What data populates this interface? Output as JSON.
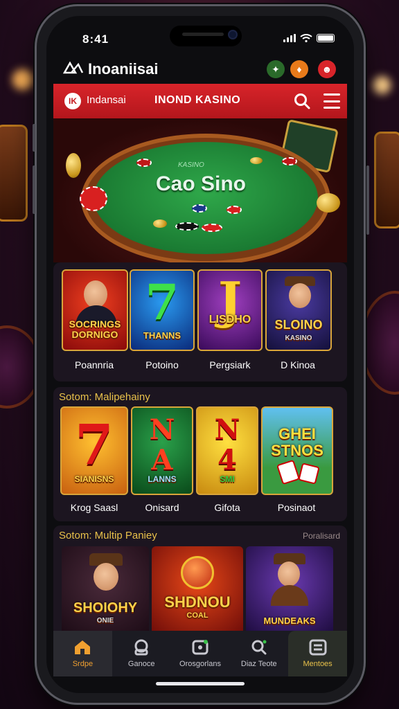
{
  "status_bar": {
    "time": "8:41"
  },
  "app_header": {
    "title": "Inoaniisai"
  },
  "navbar": {
    "brand": "Indansai",
    "title": "INOND KASINO"
  },
  "hero": {
    "felt_text": "Cao Sino",
    "felt_subtext": "KASINO"
  },
  "section_top": {
    "tiles": [
      {
        "art_text": "SOCRINGS DORNIGO",
        "label": "Poannria"
      },
      {
        "art_text": "7",
        "art_sub": "THANNS",
        "label": "Potoino"
      },
      {
        "art_text": "J",
        "art_sub": "LISDHO",
        "label": "Pergsiark"
      },
      {
        "art_text": "SLOINO",
        "art_sub": "KASINO",
        "label": "D Kinoa"
      }
    ]
  },
  "section_middle": {
    "title": "Sotom: Malipehainy",
    "tiles": [
      {
        "art_text": "7",
        "art_sub": "SIANISNS",
        "label": "Krog Saasl"
      },
      {
        "art_text": "N A",
        "art_sub": "LANNS",
        "label": "Onisard"
      },
      {
        "art_text": "N 4",
        "art_sub": "SMI",
        "label": "Gifota"
      },
      {
        "art_text": "GHEI STNOS",
        "art_sub": "",
        "label": "Posinaot"
      }
    ]
  },
  "section_bottom": {
    "title": "Sotom: Multip Paniey",
    "link": "Poralisard",
    "tiles": [
      {
        "art_text": "SHOIOHY",
        "art_sub": "ONIE"
      },
      {
        "art_text": "SHDNOU",
        "art_sub": "COAL"
      },
      {
        "art_text": "MUNDEAKS",
        "art_sub": ""
      }
    ]
  },
  "bottom_nav": {
    "items": [
      {
        "label": "Srdpe",
        "icon": "home-icon",
        "active": true
      },
      {
        "label": "Ganoce",
        "icon": "casino-icon",
        "active": false
      },
      {
        "label": "Orosgorlans",
        "icon": "games-icon",
        "active": false
      },
      {
        "label": "Diaz Teote",
        "icon": "search-icon",
        "active": false
      },
      {
        "label": "Mentoes",
        "icon": "menu-icon",
        "active": false
      }
    ]
  },
  "colors": {
    "brand_red": "#d8242a",
    "accent_gold": "#e8c14a",
    "active_nav": "#f0a030",
    "felt_green": "#1a7a32"
  }
}
